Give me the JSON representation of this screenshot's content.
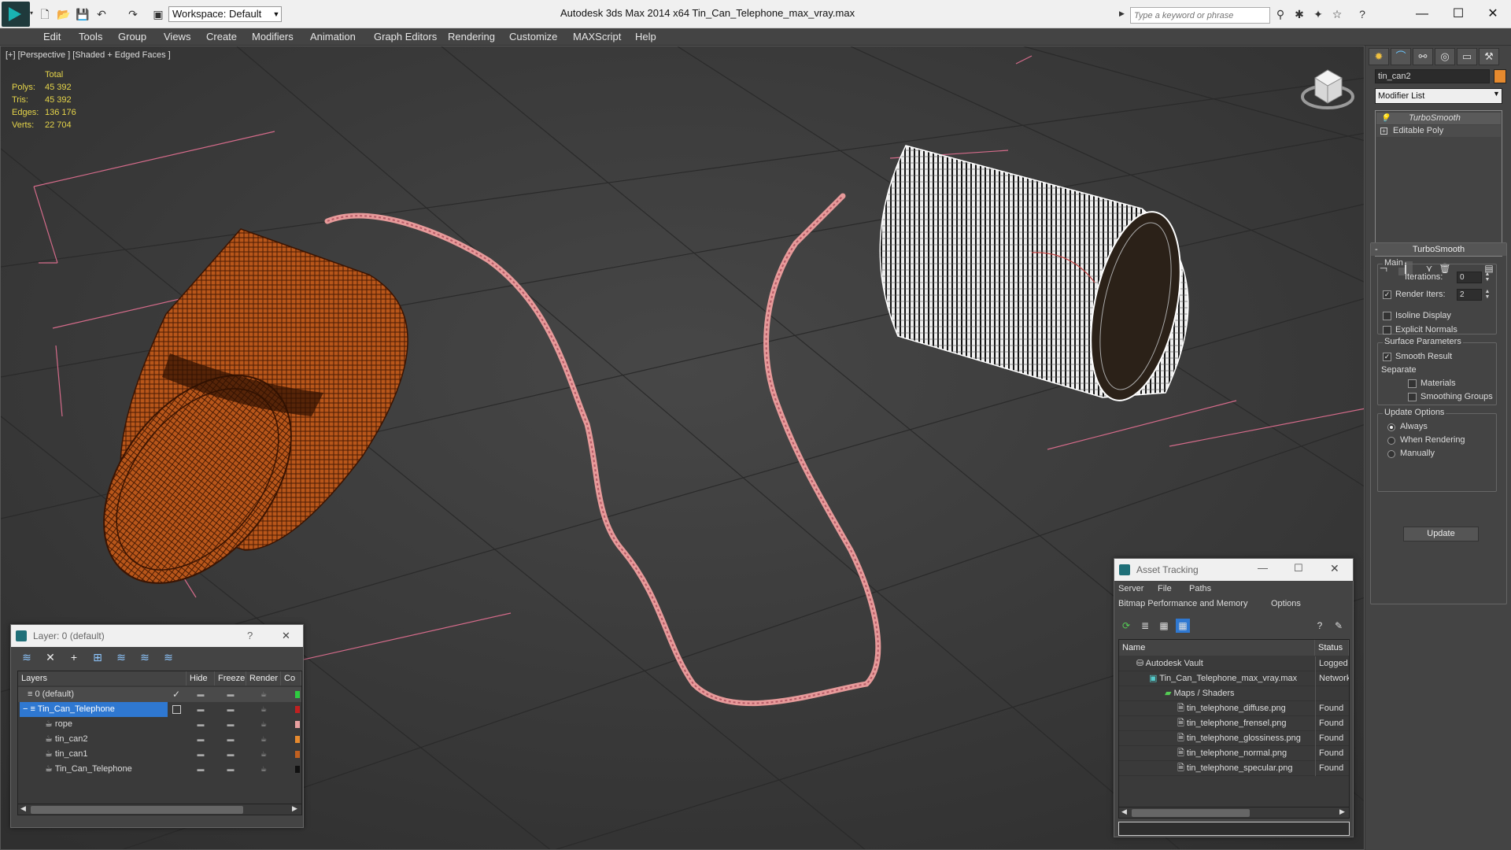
{
  "app": {
    "workspace": "Workspace: Default",
    "title": "Autodesk 3ds Max  2014 x64      Tin_Can_Telephone_max_vray.max",
    "search_placeholder": "Type a keyword or phrase"
  },
  "menus": [
    "Edit",
    "Tools",
    "Group",
    "Views",
    "Create",
    "Modifiers",
    "Animation",
    "Graph Editors",
    "Rendering",
    "Customize",
    "MAXScript",
    "Help"
  ],
  "viewport": {
    "label": "[+] [Perspective ] [Shaded + Edged Faces ]",
    "stats": {
      "total_label": "Total",
      "rows": [
        {
          "label": "Polys:",
          "value": "45 392"
        },
        {
          "label": "Tris:",
          "value": "45 392"
        },
        {
          "label": "Edges:",
          "value": "136 176"
        },
        {
          "label": "Verts:",
          "value": "22 704"
        }
      ]
    }
  },
  "command_panel": {
    "object_name": "tin_can2",
    "object_color": "#e68a2e",
    "modifier_list": "Modifier List",
    "stack": [
      "TurboSmooth",
      "Editable Poly"
    ],
    "turbosmooth": {
      "title": "TurboSmooth",
      "main": "Main",
      "iterations_label": "Iterations:",
      "iterations": "0",
      "render_iters_label": "Render Iters:",
      "render_iters": "2",
      "isoline": "Isoline Display",
      "explicit": "Explicit Normals",
      "surface": "Surface Parameters",
      "smooth_result": "Smooth Result",
      "separate": "Separate",
      "materials": "Materials",
      "smoothing_groups": "Smoothing Groups",
      "update_options": "Update Options",
      "always": "Always",
      "when_rendering": "When Rendering",
      "manually": "Manually",
      "update": "Update"
    }
  },
  "layer_dialog": {
    "title": "Layer: 0 (default)",
    "help": "?",
    "close": "✕",
    "columns": [
      "Layers",
      "Hide",
      "Freeze",
      "Render",
      "Co"
    ],
    "rows": [
      {
        "name": "0 (default)",
        "color": "#2ecc40"
      },
      {
        "name": "Tin_Can_Telephone",
        "color": "#c02020"
      },
      {
        "name": "rope",
        "color": "#e8a0a0"
      },
      {
        "name": "tin_can2",
        "color": "#e68a2e"
      },
      {
        "name": "tin_can1",
        "color": "#c06020"
      },
      {
        "name": "Tin_Can_Telephone",
        "color": "#111111"
      }
    ]
  },
  "asset_dialog": {
    "title": "Asset Tracking",
    "menu1": [
      "Server",
      "File",
      "Paths"
    ],
    "menu2": [
      "Bitmap Performance and Memory",
      "Options"
    ],
    "columns": [
      "Name",
      "Status"
    ],
    "rows": [
      {
        "name": "Autodesk Vault",
        "status": "Logged"
      },
      {
        "name": "Tin_Can_Telephone_max_vray.max",
        "status": "Network"
      },
      {
        "name": "Maps / Shaders",
        "status": ""
      },
      {
        "name": "tin_telephone_diffuse.png",
        "status": "Found"
      },
      {
        "name": "tin_telephone_frensel.png",
        "status": "Found"
      },
      {
        "name": "tin_telephone_glossiness.png",
        "status": "Found"
      },
      {
        "name": "tin_telephone_normal.png",
        "status": "Found"
      },
      {
        "name": "tin_telephone_specular.png",
        "status": "Found"
      }
    ]
  }
}
